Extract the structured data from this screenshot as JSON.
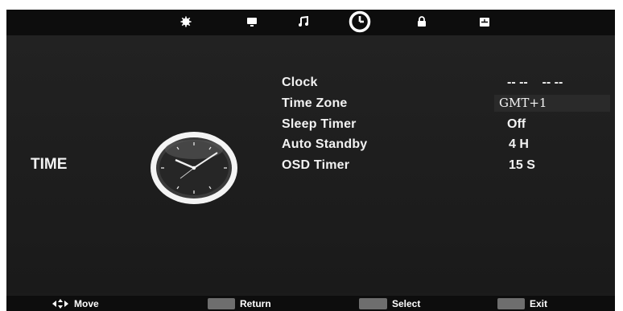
{
  "tabs": [
    {
      "icon": "picture-icon",
      "active": false
    },
    {
      "icon": "screen-icon",
      "active": false
    },
    {
      "icon": "music-note-icon",
      "active": false
    },
    {
      "icon": "clock-icon",
      "active": true
    },
    {
      "icon": "lock-icon",
      "active": false
    },
    {
      "icon": "setup-icon",
      "active": false
    }
  ],
  "section": {
    "title": "TIME"
  },
  "menu": {
    "items": [
      {
        "label": "Clock",
        "value": "-- --    -- --"
      },
      {
        "label": "Time Zone",
        "value": "GMT+1"
      },
      {
        "label": "Sleep Timer",
        "value": "Off"
      },
      {
        "label": "Auto Standby",
        "value": "4 H"
      },
      {
        "label": "OSD Timer",
        "value": "15 S"
      }
    ]
  },
  "footer": {
    "move": "Move",
    "return": "Return",
    "select": "Select",
    "exit": "Exit"
  },
  "colors": {
    "background": "#1b1b1b",
    "text": "#f2f2f2",
    "bar": "#0d0d0d"
  }
}
